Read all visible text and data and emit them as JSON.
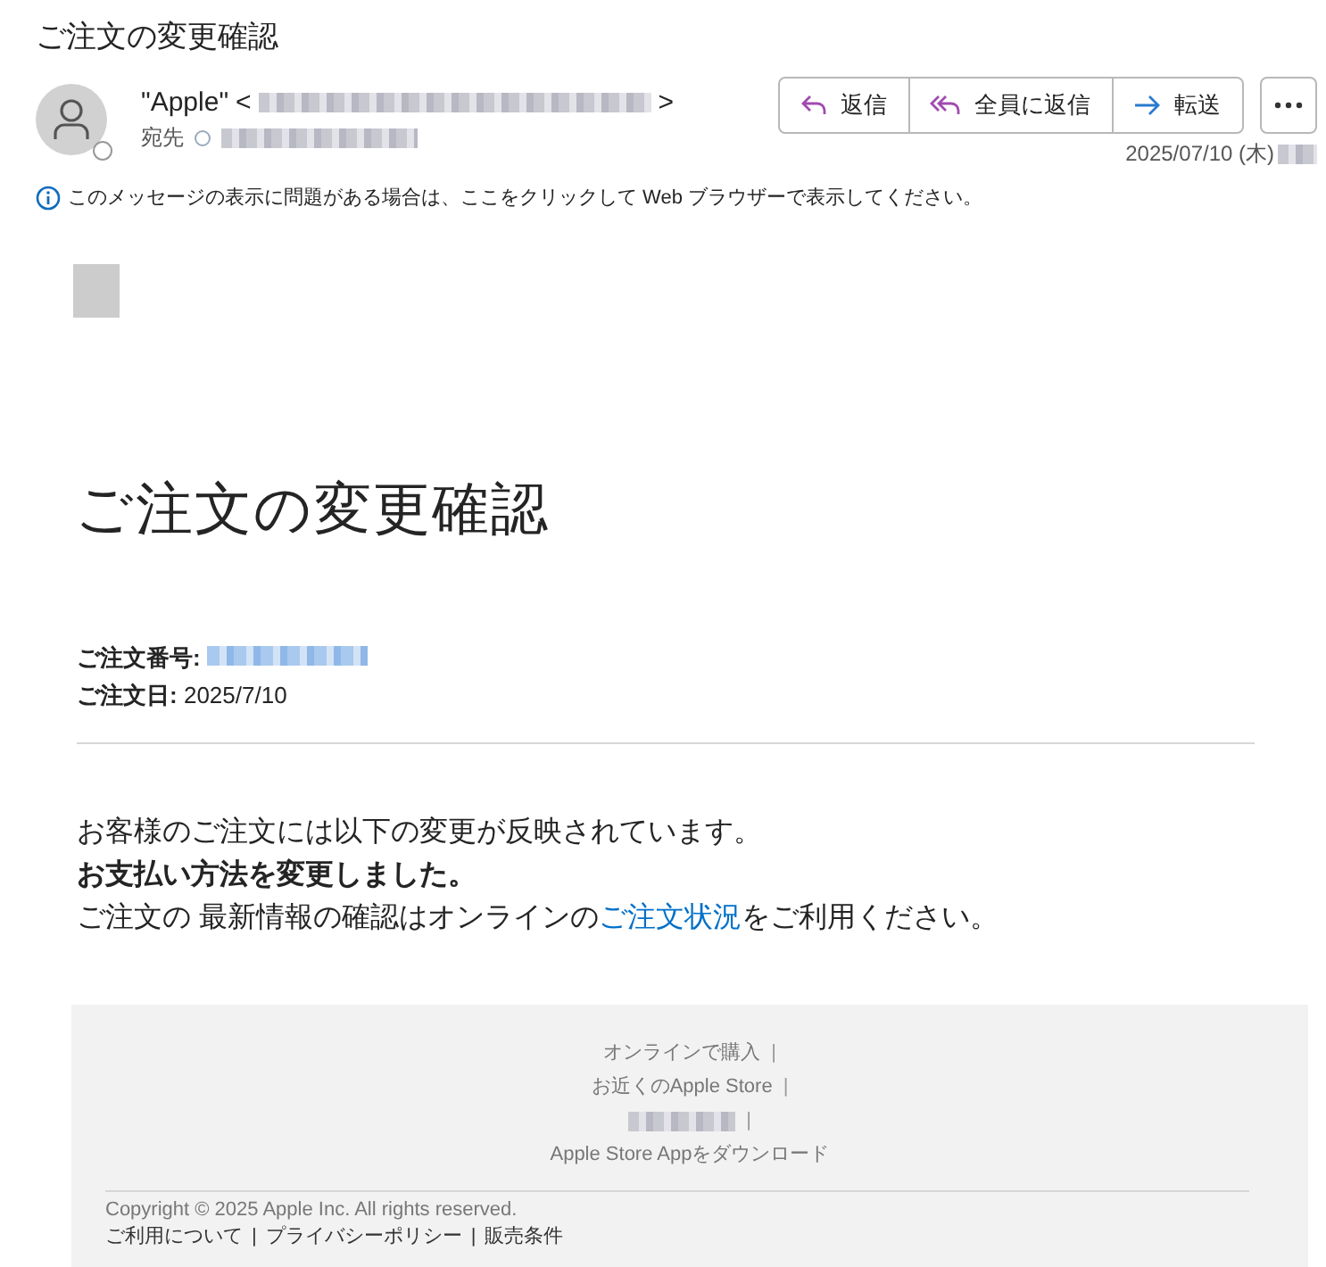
{
  "email_title": "ご注文の変更確認",
  "sender": {
    "name": "\"Apple\"",
    "open": "<",
    "close": ">"
  },
  "to_label": "宛先",
  "actions": [
    {
      "label": "返信",
      "kind": "reply"
    },
    {
      "label": "全員に返信",
      "kind": "reply_all"
    },
    {
      "label": "転送",
      "kind": "forward"
    }
  ],
  "date": "2025/07/10 (木)",
  "info": "このメッセージの表示に問題がある場合は、ここをクリックして Web ブラウザーで表示してください。",
  "heading": "ご注文の変更確認",
  "order_fields": [
    {
      "label": "ご注文番号:",
      "kind": "redacted"
    },
    {
      "label": "ご注文日:",
      "kind": "text",
      "value": "2025/7/10"
    }
  ],
  "message": [
    {
      "kind": "plain",
      "text": "お客様のご注文には以下の変更が反映されています。"
    },
    {
      "kind": "bold",
      "text": "お支払い方法を変更しました。"
    },
    {
      "kind": "link",
      "before": "ご注文の 最新情報の確認はオンラインの",
      "link": "ご注文状況",
      "after": "をご利用ください。"
    }
  ],
  "footer_links": [
    {
      "kind": "text",
      "text": "オンラインで購入",
      "separator": "|"
    },
    {
      "kind": "text",
      "text": "お近くのApple Store",
      "separator": "|"
    },
    {
      "kind": "redacted",
      "separator": "|"
    },
    {
      "kind": "text",
      "text": "Apple Store Appをダウンロード"
    }
  ],
  "copyright": "Copyright © 2025 Apple Inc. All rights reserved.",
  "legal_links": [
    {
      "text": "ご利用について",
      "separator": "|"
    },
    {
      "text": "プライバシーポリシー",
      "separator": "|"
    },
    {
      "text": "販売条件"
    }
  ]
}
